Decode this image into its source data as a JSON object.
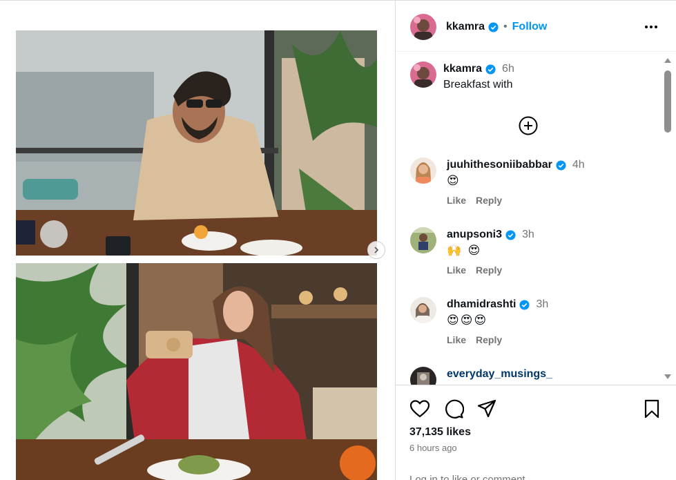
{
  "header": {
    "username": "kkamra",
    "separator": "•",
    "follow_label": "Follow"
  },
  "caption": {
    "username": "kkamra",
    "time": "6h",
    "text": "Breakfast with"
  },
  "comments": [
    {
      "username": "juuhithesoniibabbar",
      "time": "4h",
      "text": "😍",
      "like_label": "Like",
      "reply_label": "Reply"
    },
    {
      "username": "anupsoni3",
      "time": "3h",
      "text": "🙌 😍",
      "like_label": "Like",
      "reply_label": "Reply"
    },
    {
      "username": "dhamidrashti",
      "time": "3h",
      "text": "😍😍😍",
      "like_label": "Like",
      "reply_label": "Reply"
    },
    {
      "username": "everyday_musings_"
    }
  ],
  "footer": {
    "likes": "37,135 likes",
    "posted": "6 hours ago",
    "add_comment_placeholder": "Log in to like or comment."
  },
  "icons": [
    "verified-badge-icon",
    "more-options-icon",
    "plus-circle-icon",
    "heart-icon",
    "comment-icon",
    "share-icon",
    "bookmark-icon",
    "chevron-right-icon"
  ],
  "colors": {
    "accent": "#0095f6",
    "verified": "#0095f6",
    "muted": "#737373"
  }
}
